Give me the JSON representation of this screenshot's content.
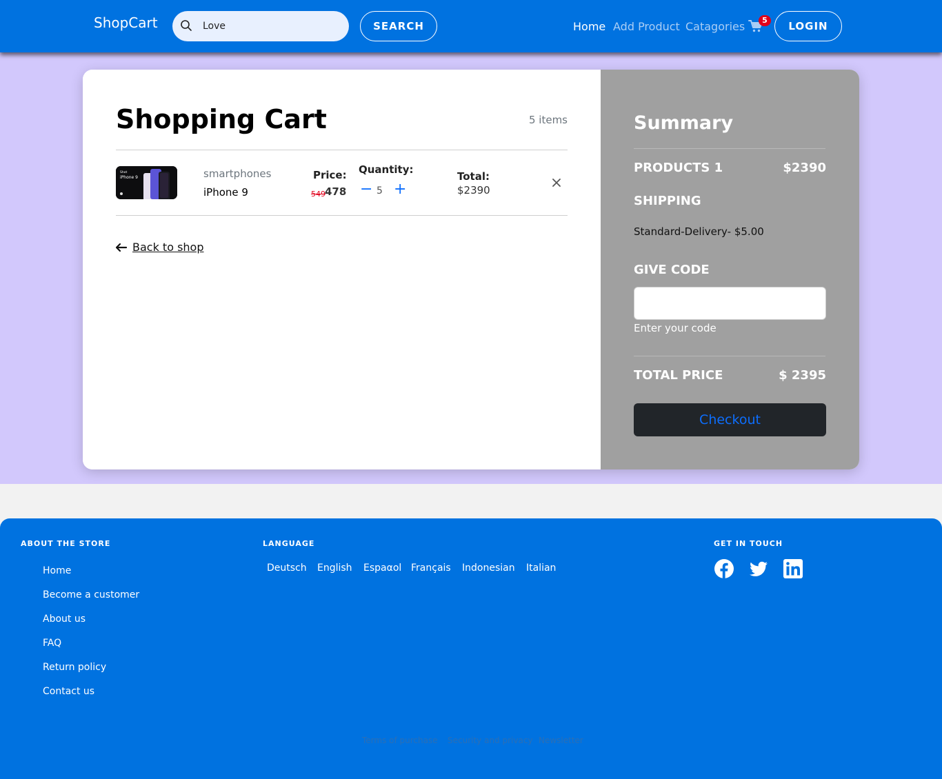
{
  "navbar": {
    "brand": "ShopCart",
    "search_value": "Love",
    "search_button": "SEARCH",
    "links": {
      "home": "Home",
      "add_product": "Add Product",
      "categories": "Catagories"
    },
    "cart_count": "5",
    "login_button": "LOGIN"
  },
  "cart": {
    "title": "Shopping Cart",
    "item_count": "5 items",
    "items": [
      {
        "category": "smartphones",
        "name": "iPhone 9",
        "price_label": "Price:",
        "price_old": "549",
        "price_new": "478",
        "quantity_label": "Quantity:",
        "quantity": "5",
        "total_label": "Total:",
        "total": "$2390",
        "image_text": "iPhone 9"
      }
    ],
    "back_link": "Back to shop"
  },
  "summary": {
    "title": "Summary",
    "products_label": "PRODUCTS 1",
    "products_total": "$2390",
    "shipping_label": "SHIPPING",
    "shipping_option": "Standard-Delivery- $5.00",
    "code_label": "GIVE CODE",
    "code_value": "",
    "code_help": "Enter your code",
    "total_label": "TOTAL PRICE",
    "total_value": "$ 2395",
    "checkout_button": "Checkout"
  },
  "footer": {
    "about_heading": "ABOUT THE STORE",
    "about_links": [
      "Home",
      "Become a customer",
      "About us",
      "FAQ",
      "Return policy",
      "Contact us"
    ],
    "language_heading": "LANGUAGE",
    "languages": [
      "Deutsch",
      "English",
      "Espaαol",
      "Français",
      "Indonesian",
      "Italian"
    ],
    "contact_heading": "GET IN TOUCH",
    "social_icons": [
      "facebook-icon",
      "twitter-icon",
      "linkedin-icon"
    ],
    "legal_links": [
      "Terms of purchase",
      "Security and privacy",
      "Newsletter"
    ]
  },
  "colors": {
    "primary": "#0072e0",
    "page_background": "#d2c8fc",
    "summary_background": "#a0a0a0",
    "checkout_background": "#212529",
    "accent_blue": "#0d6efd",
    "badge_red": "#e0001b"
  }
}
